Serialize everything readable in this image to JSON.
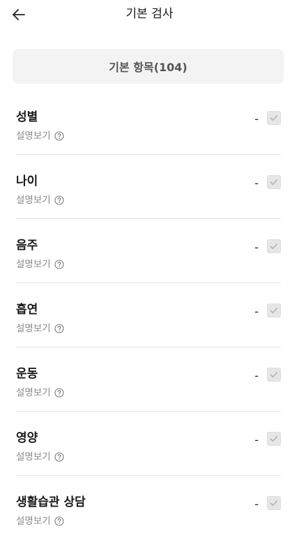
{
  "header": {
    "title": "기본 검사"
  },
  "section": {
    "label": "기본 항목(104)"
  },
  "items": [
    {
      "title": "성별",
      "desc": "설명보기",
      "value": "-",
      "checked": true
    },
    {
      "title": "나이",
      "desc": "설명보기",
      "value": "-",
      "checked": true
    },
    {
      "title": "음주",
      "desc": "설명보기",
      "value": "-",
      "checked": true
    },
    {
      "title": "흡연",
      "desc": "설명보기",
      "value": "-",
      "checked": true
    },
    {
      "title": "운동",
      "desc": "설명보기",
      "value": "-",
      "checked": true
    },
    {
      "title": "영양",
      "desc": "설명보기",
      "value": "-",
      "checked": true
    },
    {
      "title": "생활습관 상담",
      "desc": "설명보기",
      "value": "-",
      "checked": true
    }
  ],
  "icons": {
    "back": "arrow-left-icon",
    "help": "question-circle-icon",
    "check": "check-icon"
  },
  "colors": {
    "section_bg": "#f3f3f3",
    "check_bg": "#e6e6e6",
    "check_mark": "#b8b8b8",
    "muted_text": "#8a8a8a"
  }
}
